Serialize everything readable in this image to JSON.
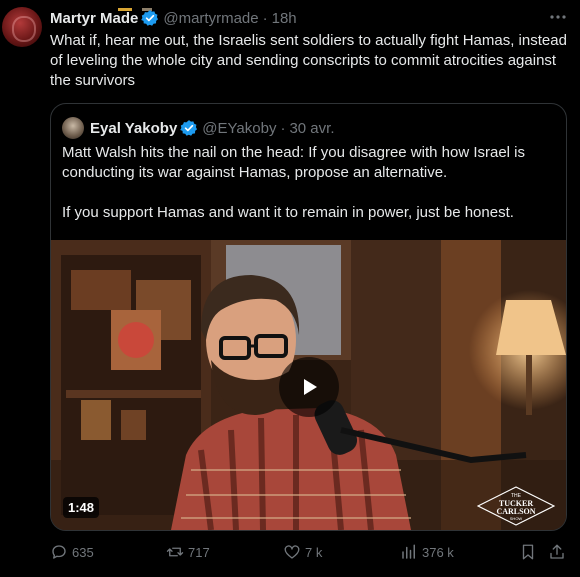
{
  "tweet": {
    "author_name": "Martyr Made",
    "handle": "@martyrmade",
    "time": "18h",
    "text": "What if, hear me out, the Israelis sent soldiers to actually fight Hamas, instead of leveling the whole city and sending conscripts to commit atrocities against the survivors"
  },
  "quoted": {
    "author_name": "Eyal Yakoby",
    "handle": "@EYakoby",
    "time": "30 avr.",
    "paragraphs": [
      "Matt Walsh hits the nail on the head: If you disagree with how Israel is conducting its war against Hamas, propose an alternative.",
      "If you support Hamas and want it to remain in power, just be honest."
    ],
    "video": {
      "duration": "1:48",
      "watermark": [
        "THE",
        "TUCKER",
        "CARLSON",
        "SHOW"
      ]
    }
  },
  "actions": {
    "replies": "635",
    "reposts": "717",
    "likes": "7 k",
    "views": "376 k"
  },
  "colors": {
    "background": "#000000",
    "text": "#e7e9ea",
    "muted": "#71767b",
    "verified": "#1d9bf0",
    "border": "#2f3336"
  }
}
